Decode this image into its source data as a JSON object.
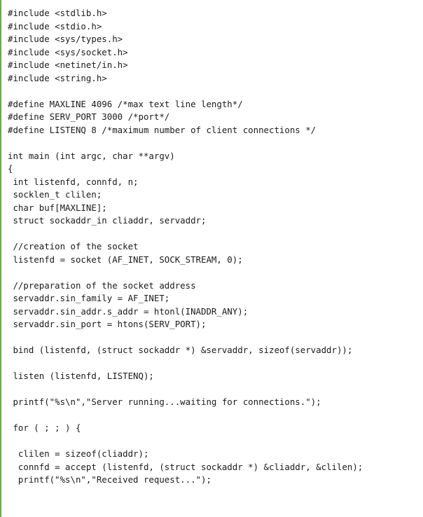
{
  "code": {
    "lines": [
      "#include <stdlib.h>",
      "#include <stdio.h>",
      "#include <sys/types.h>",
      "#include <sys/socket.h>",
      "#include <netinet/in.h>",
      "#include <string.h>",
      "",
      "#define MAXLINE 4096 /*max text line length*/",
      "#define SERV_PORT 3000 /*port*/",
      "#define LISTENQ 8 /*maximum number of client connections */",
      "",
      "int main (int argc, char **argv)",
      "{",
      " int listenfd, connfd, n;",
      " socklen_t clilen;",
      " char buf[MAXLINE];",
      " struct sockaddr_in cliaddr, servaddr;",
      "",
      " //creation of the socket",
      " listenfd = socket (AF_INET, SOCK_STREAM, 0);",
      "",
      " //preparation of the socket address",
      " servaddr.sin_family = AF_INET;",
      " servaddr.sin_addr.s_addr = htonl(INADDR_ANY);",
      " servaddr.sin_port = htons(SERV_PORT);",
      "",
      " bind (listenfd, (struct sockaddr *) &servaddr, sizeof(servaddr));",
      "",
      " listen (listenfd, LISTENQ);",
      "",
      " printf(\"%s\\n\",\"Server running...waiting for connections.\");",
      "",
      " for ( ; ; ) {",
      "",
      "  clilen = sizeof(cliaddr);",
      "  connfd = accept (listenfd, (struct sockaddr *) &cliaddr, &clilen);",
      "  printf(\"%s\\n\",\"Received request...\");"
    ]
  }
}
